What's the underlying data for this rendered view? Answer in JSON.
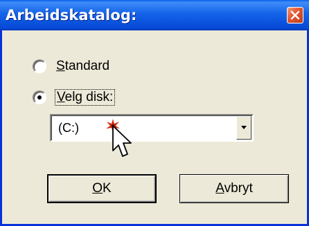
{
  "window": {
    "title": "Arbeidskatalog:",
    "close_icon": "close-x-icon",
    "colors": {
      "titlebar": "#0a5fe8",
      "close": "#e2542e",
      "face": "#ece9d8"
    }
  },
  "options": {
    "standard": {
      "prefix": "",
      "accel": "S",
      "rest": "tandard",
      "selected": false
    },
    "velg_disk": {
      "prefix": "",
      "accel": "V",
      "rest": "elg disk:",
      "selected": true
    }
  },
  "drive_select": {
    "value": "(C:)"
  },
  "buttons": {
    "ok": {
      "accel": "O",
      "rest": "K"
    },
    "cancel": {
      "accel": "A",
      "rest": "vbryt"
    }
  }
}
